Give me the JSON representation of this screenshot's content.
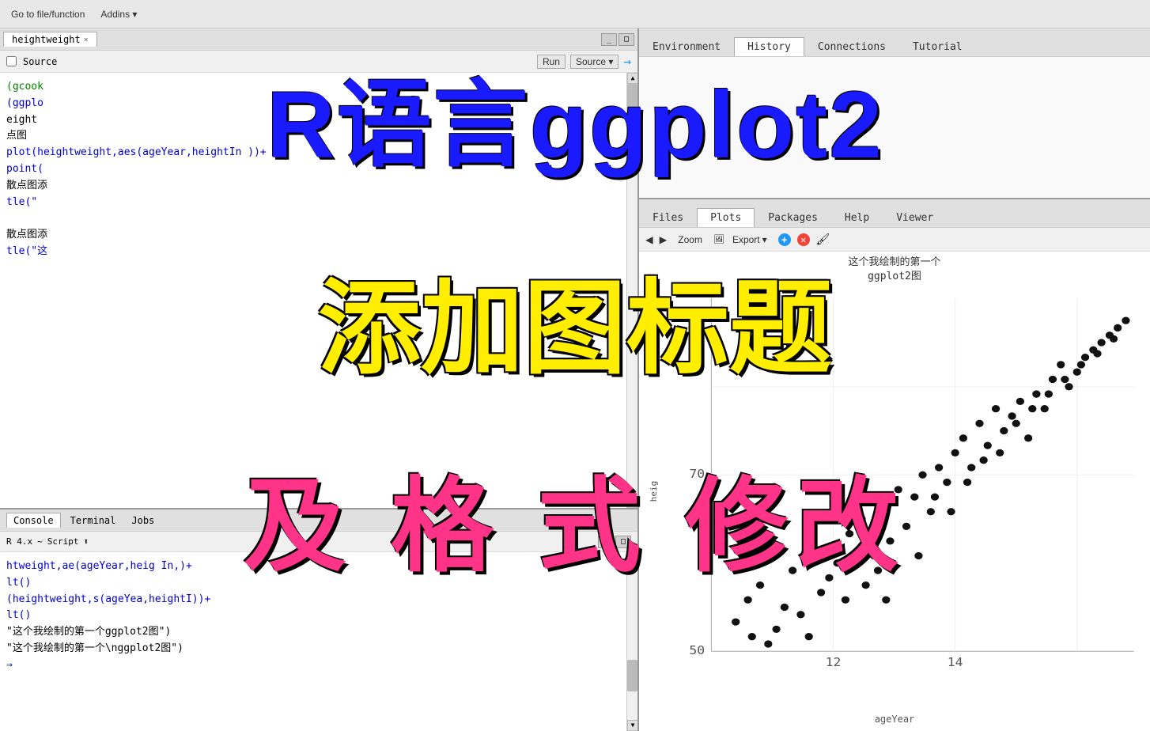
{
  "toolbar": {
    "go_to_label": "Go to file/function",
    "addins_label": "Addins"
  },
  "source_panel": {
    "tab_label": "heightweight",
    "source_checkbox": "Source",
    "toolbar_buttons": [
      "⊕",
      "Run",
      "Source ▾",
      "→"
    ],
    "code_lines": [
      "(gcook",
      "(ggplo",
      "eight",
      "点图",
      "plot(heightweight,aes(ageYear,heightIn ))+",
      "point(",
      "散点图添",
      "tle(\"",
      "",
      "散点图添",
      "tle(\"这"
    ]
  },
  "console_panel": {
    "tabs": [
      "Console",
      "Terminal",
      "Jobs"
    ],
    "active_tab": "Console",
    "script_label": "Script",
    "code_lines": [
      "htweight,ae(ageYear,heig In,)+",
      "lt()",
      "(heightweight,s(ageYea,heightI))+",
      "lt()",
      "\"这个我绘制的第一个ggplot2图\")",
      "\"这个我绘制的第一个\\nggplot2图\")"
    ]
  },
  "right_panel": {
    "top_tabs": [
      "Environment",
      "History",
      "Connections",
      "Tutorial"
    ],
    "active_top_tab": "History",
    "bottom_tabs": [
      "Files",
      "Plots",
      "Packages",
      "Help",
      "Viewer"
    ],
    "active_bottom_tab": "Plots",
    "plot_toolbar": {
      "zoom_label": "Zoom",
      "export_label": "Export"
    },
    "plot": {
      "title_line1": "这个我绘制的第一个",
      "title_line2": "ggplot2图",
      "x_axis_label": "ageYear",
      "y_axis_label": "heig",
      "x_ticks": [
        "12",
        "14"
      ],
      "y_ticks": [
        "50",
        "70"
      ]
    }
  },
  "overlay": {
    "title1": "R语言ggplot2",
    "title2": "添加图标题",
    "title3": "及 格 式 修改"
  }
}
